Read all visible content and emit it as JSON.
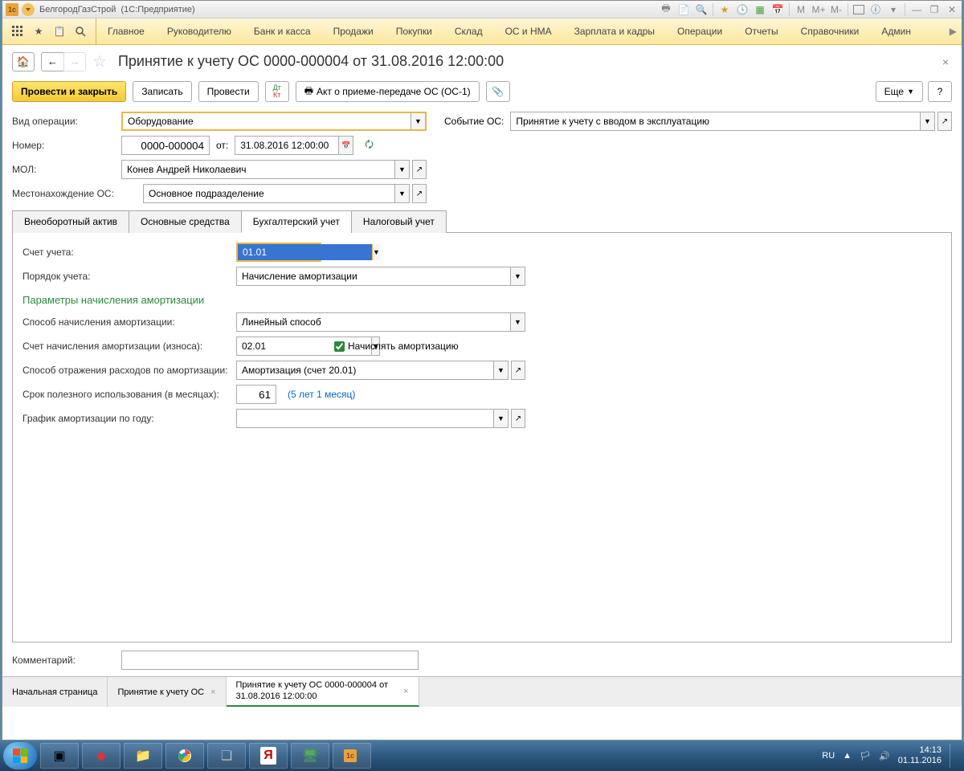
{
  "titlebar": {
    "company": "БелгородГазСтрой",
    "app": "(1С:Предприятие)",
    "mem": [
      "M",
      "M+",
      "M-"
    ]
  },
  "menu": {
    "items": [
      "Главное",
      "Руководителю",
      "Банк и касса",
      "Продажи",
      "Покупки",
      "Склад",
      "ОС и НМА",
      "Зарплата и кадры",
      "Операции",
      "Отчеты",
      "Справочники",
      "Админ"
    ]
  },
  "doc": {
    "title": "Принятие к учету ОС 0000-000004 от 31.08.2016 12:00:00"
  },
  "toolbar": {
    "post_close": "Провести и закрыть",
    "save": "Записать",
    "post": "Провести",
    "act": "Акт о приеме-передаче ОС (ОС-1)",
    "more": "Еще",
    "help": "?"
  },
  "form": {
    "vid_label": "Вид операции:",
    "vid_value": "Оборудование",
    "event_label": "Событие ОС:",
    "event_value": "Принятие к учету с вводом в эксплуатацию",
    "num_label": "Номер:",
    "num_value": "0000-000004",
    "ot_label": "от:",
    "date_value": "31.08.2016 12:00:00",
    "mol_label": "МОЛ:",
    "mol_value": "Конев Андрей Николаевич",
    "loc_label": "Местонахождение ОС:",
    "loc_value": "Основное подразделение"
  },
  "tabs": [
    "Внеоборотный актив",
    "Основные средства",
    "Бухгалтерский учет",
    "Налоговый учет"
  ],
  "acct": {
    "account_label": "Счет учета:",
    "account_value": "01.01",
    "order_label": "Порядок учета:",
    "order_value": "Начисление амортизации",
    "section": "Параметры начисления амортизации",
    "method_label": "Способ начисления амортизации:",
    "method_value": "Линейный способ",
    "depr_acc_label": "Счет начисления амортизации (износа):",
    "depr_acc_value": "02.01",
    "depr_check": "Начислять амортизацию",
    "expense_label": "Способ отражения расходов по амортизации:",
    "expense_value": "Амортизация (счет 20.01)",
    "term_label": "Срок полезного использования (в месяцах):",
    "term_value": "61",
    "term_hint": "(5 лет 1 месяц)",
    "graph_label": "График амортизации по году:",
    "graph_value": ""
  },
  "comment": {
    "label": "Комментарий:",
    "value": ""
  },
  "btabs": {
    "t1": "Начальная страница",
    "t2": "Принятие к учету ОС",
    "t3": "Принятие к учету ОС 0000-000004 от 31.08.2016 12:00:00"
  },
  "tray": {
    "lang": "RU",
    "time": "14:13",
    "date": "01.11.2016"
  }
}
